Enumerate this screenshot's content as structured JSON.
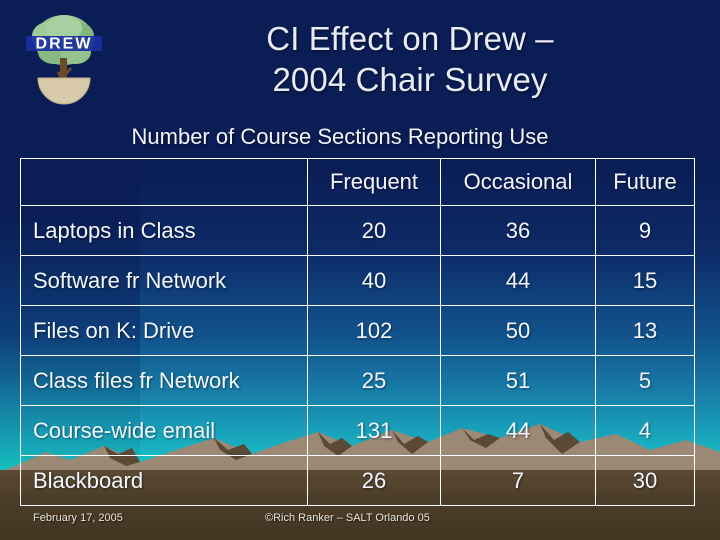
{
  "slide": {
    "title_line1": "CI Effect on Drew –",
    "title_line2": "2004 Chair Survey",
    "subtitle": "Number of Course Sections Reporting Use"
  },
  "logo": {
    "name": "drew-university-tree-logo",
    "wordmark": "DREW",
    "canopy_color": "#8fbf8a",
    "trunk_color": "#6b4b2a",
    "base_color": "#d8c9a8",
    "wordmark_color": "#1a2f9e"
  },
  "table": {
    "corner_header": "",
    "columns": [
      "Frequent",
      "Occasional",
      "Future"
    ],
    "rows": [
      {
        "label": "Laptops in Class",
        "values": [
          "20",
          "36",
          "9"
        ]
      },
      {
        "label": "Software fr Network",
        "values": [
          "40",
          "44",
          "15"
        ]
      },
      {
        "label": "Files on K: Drive",
        "values": [
          "102",
          "50",
          "13"
        ]
      },
      {
        "label": "Class files fr Network",
        "values": [
          "25",
          "51",
          "5"
        ]
      },
      {
        "label": "Course-wide email",
        "values": [
          "131",
          "44",
          "4"
        ]
      },
      {
        "label": "Blackboard",
        "values": [
          "26",
          "7",
          "30"
        ]
      }
    ]
  },
  "footer": {
    "date": "February 17, 2005",
    "credit": "©Rich Ranker – SALT Orlando 05"
  },
  "theme": {
    "sky_top": "#0a1d55",
    "sky_bottom": "#0ad9bb",
    "mountain_light": "#9b8875",
    "mountain_dark": "#594734",
    "foreground": "#4c3d2a",
    "border": "#ffffff",
    "text": "#f4f7fd"
  },
  "chart_data": {
    "type": "table",
    "title": "CI Effect on Drew – 2004 Chair Survey",
    "subtitle": "Number of Course Sections Reporting Use",
    "categories": [
      "Laptops in Class",
      "Software fr Network",
      "Files on K: Drive",
      "Class files fr Network",
      "Course-wide email",
      "Blackboard"
    ],
    "series": [
      {
        "name": "Frequent",
        "values": [
          20,
          40,
          102,
          25,
          131,
          26
        ]
      },
      {
        "name": "Occasional",
        "values": [
          36,
          44,
          50,
          51,
          44,
          7
        ]
      },
      {
        "name": "Future",
        "values": [
          9,
          15,
          13,
          5,
          4,
          30
        ]
      }
    ],
    "xlabel": "",
    "ylabel": "Number of Course Sections",
    "legend": [
      "Frequent",
      "Occasional",
      "Future"
    ],
    "grid": true
  }
}
